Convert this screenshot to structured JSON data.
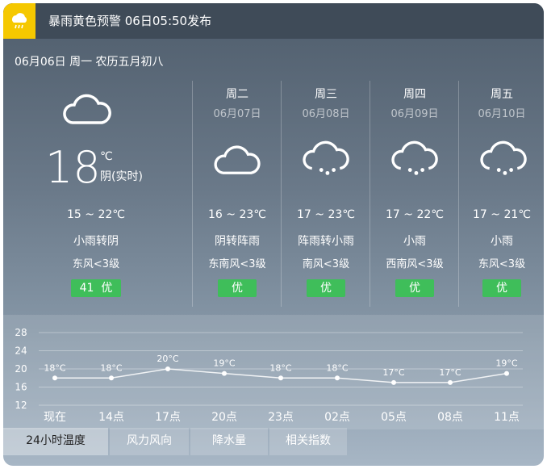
{
  "alert": {
    "text": "暴雨黄色预警 06日05:50发布",
    "icon": "rain-warning-icon",
    "color": "#f5c800"
  },
  "date_line": "06月06日 周一 农历五月初八",
  "today": {
    "temp": "18",
    "unit": "℃",
    "condition": "阴(实时)",
    "range": "15 ~ 22℃",
    "weather": "小雨转阴",
    "wind": "东风<3级",
    "aqi_value": "41",
    "aqi_level": "优",
    "icon": "cloud-icon"
  },
  "forecast": [
    {
      "weekday": "周二",
      "date": "06月07日",
      "icon": "cloud-icon",
      "range": "16 ~ 23℃",
      "weather": "阴转阵雨",
      "wind": "东南风<3级",
      "aqi": "优"
    },
    {
      "weekday": "周三",
      "date": "06月08日",
      "icon": "rain-icon",
      "range": "17 ~ 23℃",
      "weather": "阵雨转小雨",
      "wind": "南风<3级",
      "aqi": "优"
    },
    {
      "weekday": "周四",
      "date": "06月09日",
      "icon": "rain-icon",
      "range": "17 ~ 22℃",
      "weather": "小雨",
      "wind": "西南风<3级",
      "aqi": "优"
    },
    {
      "weekday": "周五",
      "date": "06月10日",
      "icon": "rain-icon",
      "range": "17 ~ 21℃",
      "weather": "小雨",
      "wind": "东风<3级",
      "aqi": "优"
    }
  ],
  "tabs": [
    "24小时温度",
    "风力风向",
    "降水量",
    "相关指数"
  ],
  "colors": {
    "aqi_good": "#3fbe5a"
  },
  "chart_data": {
    "type": "line",
    "categories": [
      "现在",
      "14点",
      "17点",
      "20点",
      "23点",
      "02点",
      "05点",
      "08点",
      "11点"
    ],
    "values": [
      18,
      18,
      20,
      19,
      18,
      18,
      17,
      17,
      19
    ],
    "point_labels": [
      "18°C",
      "18°C",
      "20°C",
      "19°C",
      "18°C",
      "18°C",
      "17°C",
      "17°C",
      "19°C"
    ],
    "yticks": [
      "28",
      "24",
      "20",
      "16",
      "12"
    ],
    "ylim": [
      12,
      28
    ],
    "grid": true
  }
}
